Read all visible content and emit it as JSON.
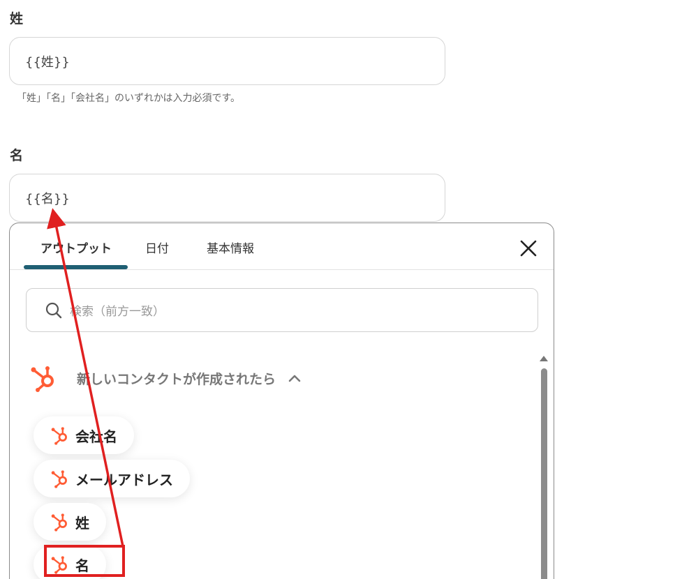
{
  "fields": {
    "last_name": {
      "label": "姓",
      "value": "{{姓}}"
    },
    "hint": "「姓」「名」「会社名」のいずれかは入力必須です。",
    "first_name": {
      "label": "名",
      "value": "{{名}}"
    }
  },
  "popup": {
    "tabs": [
      {
        "label": "アウトプット",
        "active": true
      },
      {
        "label": "日付",
        "active": false
      },
      {
        "label": "基本情報",
        "active": false
      }
    ],
    "search_placeholder": "検索（前方一致）",
    "group": {
      "title": "新しいコンタクトが作成されたら",
      "items": [
        {
          "label": "会社名"
        },
        {
          "label": "メールアドレス"
        },
        {
          "label": "姓"
        },
        {
          "label": "名"
        }
      ]
    }
  },
  "colors": {
    "hubspot": "#ff5c35",
    "tab_underline": "#1f5f73",
    "annotation": "#e02020"
  },
  "icons": {
    "close": "close-icon",
    "search": "search-icon",
    "hubspot": "hubspot-icon",
    "chevron": "chevron-up-icon"
  }
}
